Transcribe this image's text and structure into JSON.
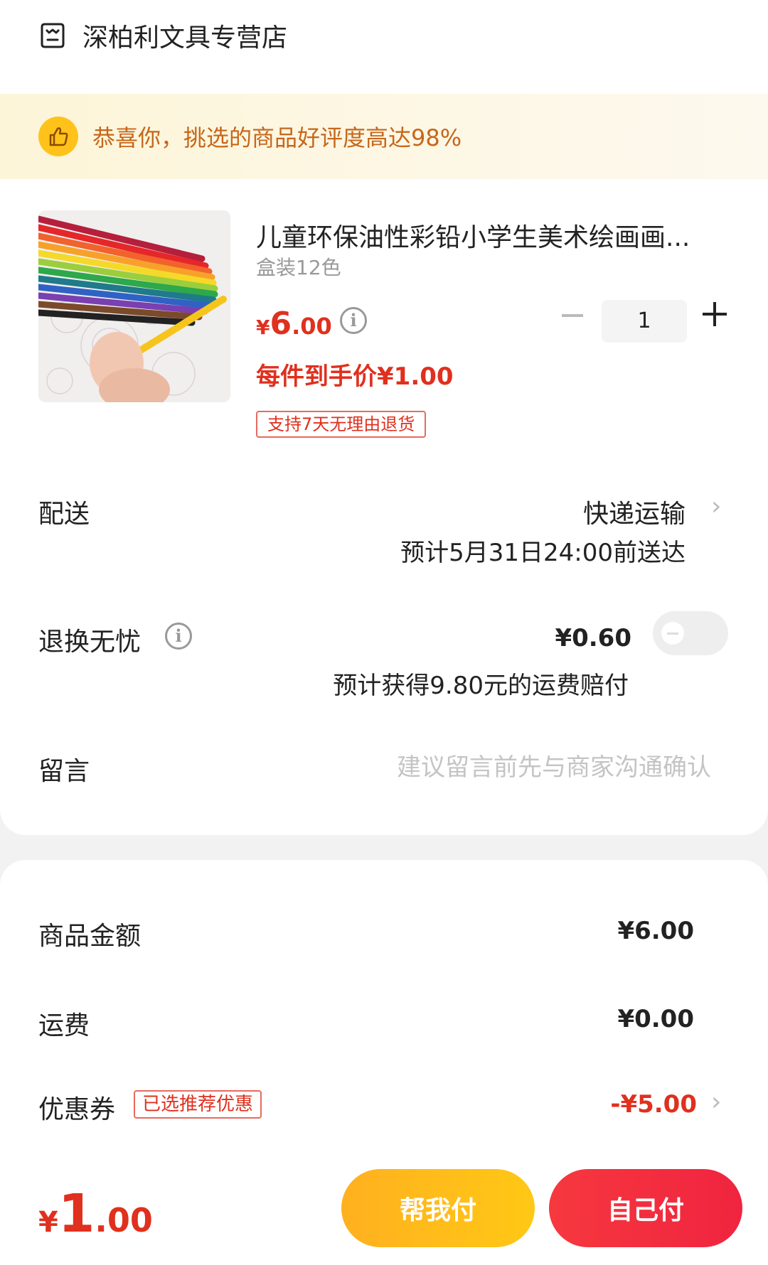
{
  "shop": {
    "name": "深柏利文具专营店",
    "icon": "store-icon"
  },
  "banner": {
    "text": "恭喜你，挑选的商品好评度高达98%",
    "icon": "thumbs-up-icon"
  },
  "product": {
    "title": "儿童环保油性彩铅小学生美术绘画画...",
    "spec": "盒装12色",
    "price_symbol": "¥",
    "price_int": "6",
    "price_dec": ".00",
    "unit_price": "每件到手价¥1.00",
    "return_tag": "支持7天无理由退货",
    "quantity": "1"
  },
  "delivery": {
    "label": "配送",
    "method": "快递运输",
    "eta": "预计5月31日24:00前送达"
  },
  "return_insurance": {
    "label": "退换无忧",
    "price": "¥0.60",
    "compensation": "预计获得9.80元的运费赔付",
    "enabled": false
  },
  "message": {
    "label": "留言",
    "placeholder": "建议留言前先与商家沟通确认"
  },
  "summary": {
    "goods_label": "商品金额",
    "goods_value": "¥6.00",
    "shipping_label": "运费",
    "shipping_value": "¥0.00",
    "coupon_label": "优惠券",
    "coupon_tag": "已选推荐优惠",
    "coupon_value": "-¥5.00"
  },
  "footer": {
    "total_symbol": "¥",
    "total_int": "1",
    "total_dec": ".00",
    "help_pay": "帮我付",
    "self_pay": "自己付"
  },
  "colors": {
    "accent_red": "#e0301e",
    "banner_text": "#c6671b",
    "help_button": "#ffbb1a",
    "self_button": "#f3303f"
  }
}
